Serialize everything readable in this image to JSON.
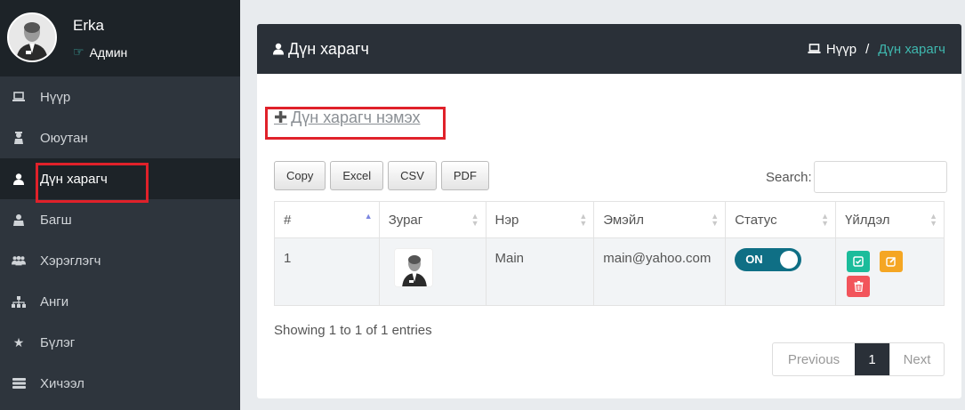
{
  "user": {
    "name": "Erka",
    "role": "Админ"
  },
  "nav": {
    "items": [
      {
        "label": "Нүүр",
        "icon": "laptop-icon"
      },
      {
        "label": "Оюутан",
        "icon": "graduate-icon"
      },
      {
        "label": "Дүн харагч",
        "icon": "user-icon"
      },
      {
        "label": "Багш",
        "icon": "teacher-icon"
      },
      {
        "label": "Хэрэглэгч",
        "icon": "users-icon"
      },
      {
        "label": "Анги",
        "icon": "sitemap-icon"
      },
      {
        "label": "Бүлэг",
        "icon": "star-icon"
      },
      {
        "label": "Хичээл",
        "icon": "list-icon"
      }
    ]
  },
  "header": {
    "title": "Дүн харагч",
    "breadcrumb": {
      "home": "Нүүр",
      "separator": "/",
      "current": "Дүн харагч"
    }
  },
  "add_link": "Дүн харагч нэмэх",
  "export_buttons": [
    "Copy",
    "Excel",
    "CSV",
    "PDF"
  ],
  "search": {
    "label": "Search:",
    "value": ""
  },
  "table": {
    "columns": [
      "#",
      "Зураг",
      "Нэр",
      "Эмэйл",
      "Статус",
      "Үйлдэл"
    ],
    "rows": [
      {
        "index": "1",
        "name": "Main",
        "email": "main@yahoo.com",
        "status": "ON"
      }
    ]
  },
  "info": "Showing 1 to 1 of 1 entries",
  "pagination": {
    "previous": "Previous",
    "current": "1",
    "next": "Next"
  },
  "colors": {
    "sidebar": "#2e353d",
    "header": "#2a3038",
    "accent": "#3fb8af",
    "highlight": "#e0212a",
    "approve": "#1bbc9b",
    "edit": "#f5a623",
    "delete": "#f2545b"
  }
}
